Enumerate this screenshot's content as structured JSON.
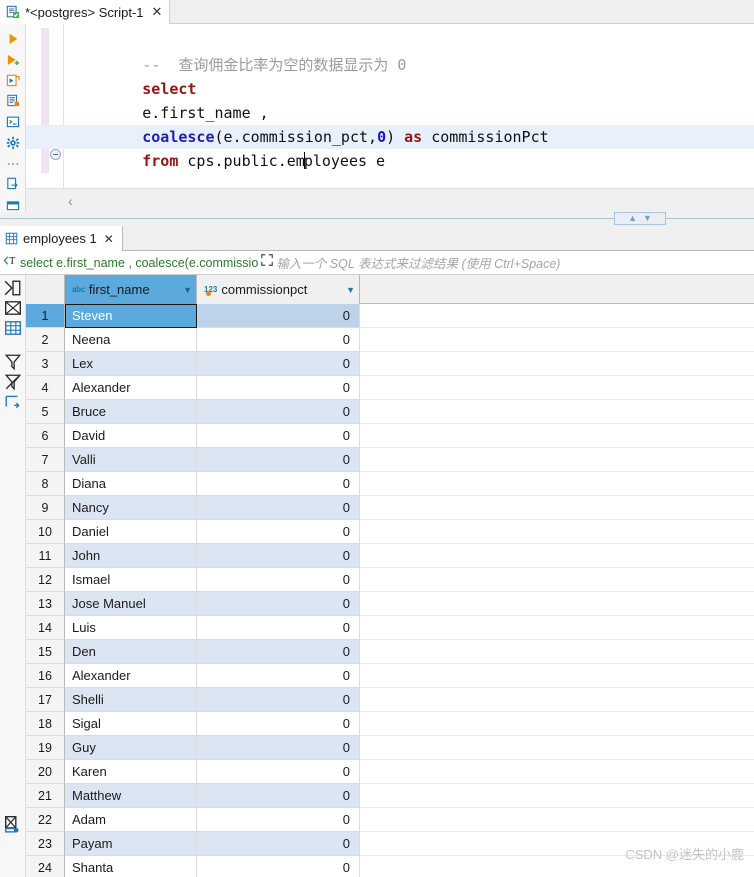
{
  "editor": {
    "tab": {
      "title": "*<postgres> Script-1",
      "close": "✕",
      "icon": "sql-script-icon"
    },
    "rail_icons": [
      "execute-statement-icon",
      "execute-script-icon",
      "execute-script-new-tab-icon",
      "explain-plan-icon",
      "execute-in-console-icon",
      "sql-settings-icon",
      "more-options-icon",
      "export-from-query-icon",
      "panel-icon"
    ],
    "lines": [
      {
        "comment": "--  查询佣金比率为空的数据显示为 0"
      },
      {
        "keyword": "select"
      },
      {
        "plain": "e.first_name ,"
      },
      {
        "fn": "coalesce",
        "plain1": "(e.commission_pct,",
        "num": "0",
        "plain2": ") ",
        "kw2": "as",
        "plain3": " commissionPct"
      },
      {
        "kw": "from",
        "plain": " cps.public.employees e"
      }
    ],
    "collapse_chevron": "‹"
  },
  "splitter": {
    "up": "▲",
    "down": "▼"
  },
  "results": {
    "tab": {
      "title": "employees 1",
      "close": "✕",
      "icon": "grid-icon"
    },
    "filter": {
      "icon": "filter-text-icon",
      "value": "select e.first_name , coalesce(e.commissio",
      "expand_icon": "expand-icon",
      "placeholder": "输入一个 SQL 表达式来过滤结果 (使用 Ctrl+Space)"
    },
    "grid_rail_icons": [
      "grid-presentation-icon",
      "record-view-icon",
      "grid-view-icon",
      "filter-toggle-icon",
      "clear-filter-icon",
      "transpose-icon",
      "calc-panel-icon"
    ],
    "columns": [
      {
        "name": "first_name",
        "type_icon": "abc",
        "selected": true,
        "caret": "▼"
      },
      {
        "name": "commissionpct",
        "type_icon": "123",
        "selected": false,
        "caret": "▼"
      }
    ],
    "rows": [
      {
        "n": "1",
        "first_name": "Steven",
        "commissionpct": "0"
      },
      {
        "n": "2",
        "first_name": "Neena",
        "commissionpct": "0"
      },
      {
        "n": "3",
        "first_name": "Lex",
        "commissionpct": "0"
      },
      {
        "n": "4",
        "first_name": "Alexander",
        "commissionpct": "0"
      },
      {
        "n": "5",
        "first_name": "Bruce",
        "commissionpct": "0"
      },
      {
        "n": "6",
        "first_name": "David",
        "commissionpct": "0"
      },
      {
        "n": "7",
        "first_name": "Valli",
        "commissionpct": "0"
      },
      {
        "n": "8",
        "first_name": "Diana",
        "commissionpct": "0"
      },
      {
        "n": "9",
        "first_name": "Nancy",
        "commissionpct": "0"
      },
      {
        "n": "10",
        "first_name": "Daniel",
        "commissionpct": "0"
      },
      {
        "n": "11",
        "first_name": "John",
        "commissionpct": "0"
      },
      {
        "n": "12",
        "first_name": "Ismael",
        "commissionpct": "0"
      },
      {
        "n": "13",
        "first_name": "Jose Manuel",
        "commissionpct": "0"
      },
      {
        "n": "14",
        "first_name": "Luis",
        "commissionpct": "0"
      },
      {
        "n": "15",
        "first_name": "Den",
        "commissionpct": "0"
      },
      {
        "n": "16",
        "first_name": "Alexander",
        "commissionpct": "0"
      },
      {
        "n": "17",
        "first_name": "Shelli",
        "commissionpct": "0"
      },
      {
        "n": "18",
        "first_name": "Sigal",
        "commissionpct": "0"
      },
      {
        "n": "19",
        "first_name": "Guy",
        "commissionpct": "0"
      },
      {
        "n": "20",
        "first_name": "Karen",
        "commissionpct": "0"
      },
      {
        "n": "21",
        "first_name": "Matthew",
        "commissionpct": "0"
      },
      {
        "n": "22",
        "first_name": "Adam",
        "commissionpct": "0"
      },
      {
        "n": "23",
        "first_name": "Payam",
        "commissionpct": "0"
      },
      {
        "n": "24",
        "first_name": "Shanta",
        "commissionpct": "0"
      }
    ]
  },
  "watermark": "CSDN @迷失的小鹿",
  "colors": {
    "accent": "#5ba9dd",
    "stripe": "#dce6f2",
    "keyword": "#9b1414",
    "function": "#1f1fb0",
    "number": "#1414c8",
    "comment": "#9b9b9b",
    "filter_text": "#2c7a2c"
  }
}
